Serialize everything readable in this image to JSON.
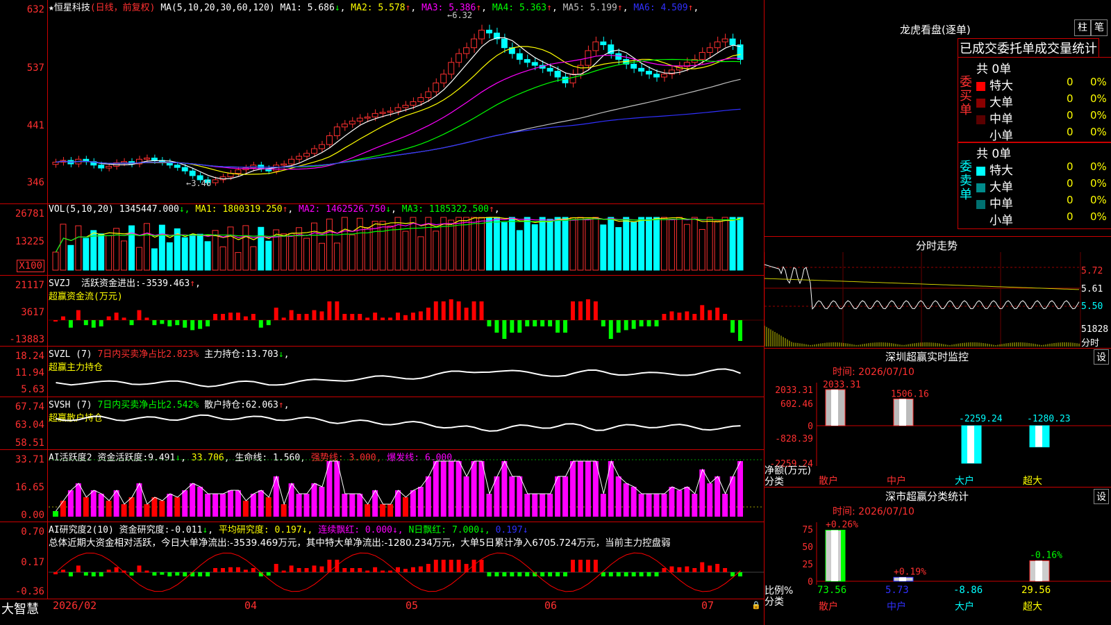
{
  "header": {
    "star": "★",
    "stock_name": "恒星科技",
    "period": "(日线，前复权)",
    "ma_label": "MA(5,10,20,30,60,120)",
    "ma": [
      {
        "label": "MA1:",
        "value": "5.686",
        "arrow": "↓",
        "color": "#ffffff"
      },
      {
        "label": "MA2:",
        "value": "5.578",
        "arrow": "↑",
        "color": "#ffff00"
      },
      {
        "label": "MA3:",
        "value": "5.386",
        "arrow": "↑",
        "color": "#ff00ff"
      },
      {
        "label": "MA4:",
        "value": "5.363",
        "arrow": "↑",
        "color": "#00ff00"
      },
      {
        "label": "MA5:",
        "value": "5.199",
        "arrow": "↑",
        "color": "#c0c0c0"
      },
      {
        "label": "MA6:",
        "value": "4.509",
        "arrow": "↑",
        "color": "#3030ff"
      }
    ],
    "high_marker": "6.32",
    "low_marker": "3.46"
  },
  "price_axis": [
    "632",
    "537",
    "441",
    "346"
  ],
  "vol": {
    "label": "VOL(5,10,20)",
    "value": "1345447.000",
    "ma": [
      {
        "label": "MA1:",
        "value": "1800319.250",
        "arrow": "↑",
        "color": "#ffff00"
      },
      {
        "label": "MA2:",
        "value": "1462526.750",
        "arrow": "↓",
        "color": "#ff00ff"
      },
      {
        "label": "MA3:",
        "value": "1185322.500",
        "arrow": "↑",
        "color": "#00ff00"
      }
    ],
    "axis": [
      "26781",
      "13225"
    ],
    "unit": "X100"
  },
  "svzj": {
    "label": "SVZJ",
    "title": "活跃资金进出:",
    "value": "-3539.463",
    "arrow": "↑",
    "sub": "超赢资金流(万元)",
    "axis": [
      "21117",
      "3617",
      "-13883"
    ]
  },
  "svzl": {
    "label": "SVZL (7)",
    "note": "7日内买卖净占比2.823%",
    "title": "主力持仓:",
    "value": "13.703",
    "arrow": "↓",
    "sub": "超赢主力持仓",
    "axis": [
      "18.24",
      "11.94",
      "5.63"
    ]
  },
  "svsh": {
    "label": "SVSH (7)",
    "note": "7日内买卖净占比2.542%",
    "title": "散户持仓:",
    "value": "62.063",
    "arrow": "↑",
    "sub": "超赢散户持仓",
    "axis": [
      "67.74",
      "63.04",
      "58.51"
    ]
  },
  "ai_act": {
    "label": "AI活跃度2",
    "title": "资金活跃度:",
    "value": "9.491",
    "arrow": "↓",
    "v2": "33.706",
    "life": "生命线: 1.560,",
    "strong": "强势线: 3.000,",
    "burst": "爆发线: 6.000,",
    "axis": [
      "33.71",
      "16.65",
      "0.00"
    ]
  },
  "ai_res": {
    "label": "AI研究度2(10)",
    "title": "资金研究度:",
    "value": "-0.011",
    "arrow": "↓",
    "avg": "平均研究度: 0.197↓,",
    "lianxu": "连续飘红: 0.000↓,",
    "nday": "N日飘红: 7.000↓,",
    "last": "0.197↓",
    "summary": "总体近期大资金相对活跃，今日大单净流出:-3539.469万元，其中特大单净流出:-1280.234万元，大单5日累计净入6705.724万元，当前主力控盘弱",
    "axis": [
      "0.70",
      "0.17",
      "-0.36"
    ]
  },
  "date_axis": [
    "2026/02",
    "04",
    "05",
    "06",
    "07"
  ],
  "brand": "大智慧",
  "dragon": {
    "title": "龙虎看盘(逐单)",
    "btn1": "柱",
    "btn2": "笔",
    "cols": "已成交委托单成交量统计",
    "buy_label": "委买单",
    "sell_label": "委卖单",
    "buy_total": "共 0单",
    "sell_total": "共 0单",
    "buy": [
      {
        "name": "特大",
        "color": "#ff0000",
        "count": "0",
        "pct": "0%"
      },
      {
        "name": "大单",
        "color": "#8b0000",
        "count": "0",
        "pct": "0%"
      },
      {
        "name": "中单",
        "color": "#5a0000",
        "count": "0",
        "pct": "0%"
      },
      {
        "name": "小单",
        "color": "#000000",
        "count": "0",
        "pct": "0%"
      }
    ],
    "sell": [
      {
        "name": "特大",
        "color": "#00ffff",
        "count": "0",
        "pct": "0%"
      },
      {
        "name": "大单",
        "color": "#008b8b",
        "count": "0",
        "pct": "0%"
      },
      {
        "name": "中单",
        "color": "#007070",
        "count": "0",
        "pct": "0%"
      },
      {
        "name": "小单",
        "color": "#000000",
        "count": "0",
        "pct": "0%"
      }
    ]
  },
  "intraday": {
    "title": "分时走势",
    "axis": [
      "5.72",
      "5.61",
      "5.50"
    ],
    "vol": "51828",
    "unit": "分时"
  },
  "monitor": {
    "title": "深圳超赢实时监控",
    "set": "设",
    "time": "时间: 2026/07/10",
    "axis": [
      "2033.31",
      "602.46",
      "0",
      "-828.39",
      "-2259.24"
    ],
    "ylabel": "净额(万元)",
    "xlabel": "分类",
    "cats": [
      "散户",
      "中户",
      "大户",
      "超大"
    ],
    "chart_data": {
      "type": "bar",
      "categories": [
        "散户",
        "中户",
        "大户",
        "超大"
      ],
      "values": [
        2033.31,
        1506.16,
        -2259.24,
        -1280.23
      ],
      "ylim": [
        -2259.24,
        2033.31
      ]
    }
  },
  "stats": {
    "title": "深市超赢分类统计",
    "set": "设",
    "time": "时间: 2026/07/10",
    "axis": [
      "75",
      "50",
      "25",
      "0"
    ],
    "ylabel": "比例%",
    "xlabel": "分类",
    "cats": [
      "散户",
      "中户",
      "大户",
      "超大"
    ],
    "changes": [
      "+0.26%",
      "+0.19%",
      "",
      "-0.16%"
    ],
    "values": [
      "73.56",
      "5.73",
      "-8.86",
      "29.56"
    ],
    "chart_data": {
      "type": "bar",
      "categories": [
        "散户",
        "中户",
        "大户",
        "超大"
      ],
      "values": [
        73.56,
        5.73,
        -8.86,
        29.56
      ],
      "ylim": [
        0,
        75
      ]
    }
  },
  "chart_data": {
    "type": "candlestick",
    "title": "恒星科技 (日线，前复权)",
    "ylim": [
      3.46,
      6.32
    ],
    "annotations": {
      "high": 6.32,
      "low": 3.46
    },
    "note": "Daily K-line approx values (close) sampled left to right",
    "close": [
      3.85,
      3.88,
      3.82,
      3.9,
      3.86,
      3.8,
      3.75,
      3.78,
      3.84,
      3.86,
      3.82,
      3.9,
      3.92,
      3.88,
      3.85,
      3.8,
      3.76,
      3.7,
      3.62,
      3.55,
      3.5,
      3.55,
      3.6,
      3.66,
      3.72,
      3.75,
      3.8,
      3.74,
      3.7,
      3.8,
      3.82,
      3.9,
      3.95,
      4.0,
      4.08,
      4.15,
      4.3,
      4.45,
      4.5,
      4.55,
      4.6,
      4.62,
      4.68,
      4.7,
      4.72,
      4.78,
      4.82,
      4.88,
      4.95,
      5.05,
      5.2,
      5.35,
      5.55,
      5.7,
      5.8,
      5.95,
      6.1,
      6.05,
      5.95,
      5.8,
      5.7,
      5.6,
      5.55,
      5.5,
      5.45,
      5.4,
      5.3,
      5.2,
      5.35,
      5.5,
      5.75,
      5.9,
      5.85,
      5.7,
      5.6,
      5.52,
      5.45,
      5.4,
      5.35,
      5.3,
      5.35,
      5.42,
      5.48,
      5.55,
      5.6,
      5.72,
      5.8,
      5.9,
      5.95,
      5.85,
      5.6
    ]
  }
}
